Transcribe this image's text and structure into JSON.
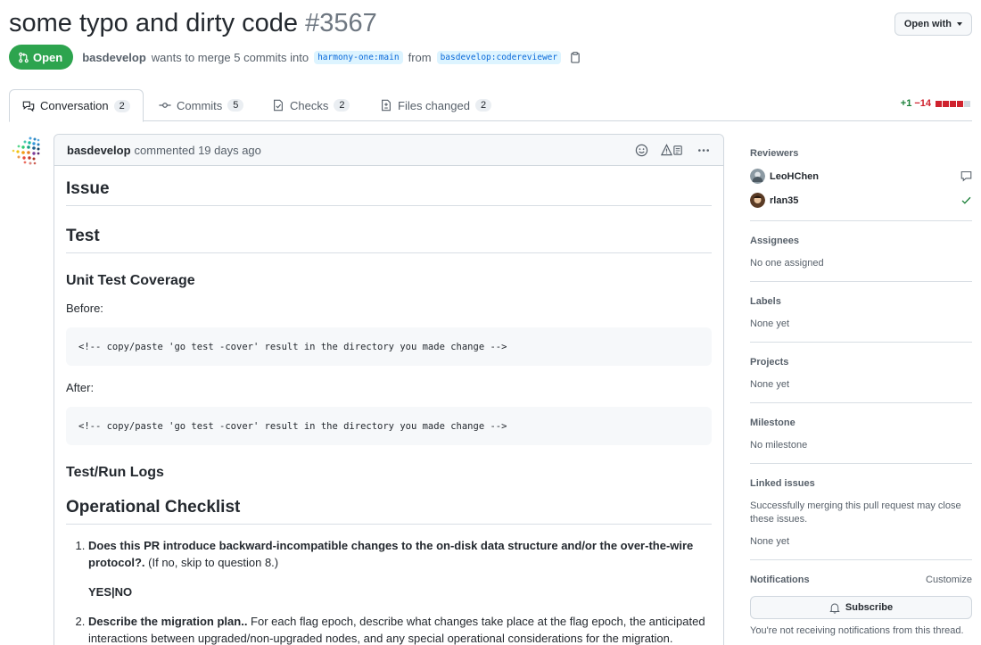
{
  "header": {
    "title": "some typo and dirty code",
    "number": "#3567",
    "open_with_label": "Open with"
  },
  "meta": {
    "state": "Open",
    "author": "basdevelop",
    "merge_text": "wants to merge 5 commits into",
    "base_branch": "harmony-one:main",
    "from_text": "from",
    "head_branch": "basdevelop:codereviewer"
  },
  "tabs": [
    {
      "label": "Conversation",
      "count": "2"
    },
    {
      "label": "Commits",
      "count": "5"
    },
    {
      "label": "Checks",
      "count": "2"
    },
    {
      "label": "Files changed",
      "count": "2"
    }
  ],
  "diffstat": {
    "additions": "+1",
    "deletions": "−14"
  },
  "comment": {
    "author": "basdevelop",
    "action": "commented 19 days ago",
    "h_issue": "Issue",
    "h_test": "Test",
    "h_coverage": "Unit Test Coverage",
    "before": "Before:",
    "code1": "<!-- copy/paste 'go test -cover' result in the directory you made change -->",
    "after": "After:",
    "code2": "<!-- copy/paste 'go test -cover' result in the directory you made change -->",
    "h_logs": "Test/Run Logs",
    "h_checklist": "Operational Checklist",
    "q1_bold": "Does this PR introduce backward-incompatible changes to the on-disk data structure and/or the over-the-wire protocol?.",
    "q1_rest": " (If no, skip to question 8.)",
    "q1_answer": "YES|NO",
    "q2_bold": "Describe the migration plan..",
    "q2_rest": " For each flag epoch, describe what changes take place at the flag epoch, the anticipated interactions between upgraded/non-upgraded nodes, and any special operational considerations for the migration."
  },
  "sidebar": {
    "reviewers_title": "Reviewers",
    "reviewers": [
      {
        "name": "LeoHChen"
      },
      {
        "name": "rlan35"
      }
    ],
    "assignees_title": "Assignees",
    "assignees_value": "No one assigned",
    "labels_title": "Labels",
    "labels_value": "None yet",
    "projects_title": "Projects",
    "projects_value": "None yet",
    "milestone_title": "Milestone",
    "milestone_value": "No milestone",
    "linked_title": "Linked issues",
    "linked_desc": "Successfully merging this pull request may close these issues.",
    "linked_value": "None yet",
    "notifications_title": "Notifications",
    "customize_label": "Customize",
    "subscribe_label": "Subscribe",
    "notice": "You're not receiving notifications from this thread."
  },
  "colors": {
    "open_green": "#2da44e",
    "link_blue": "#0969da",
    "add_green": "#1a7f37",
    "delete_red": "#cf222e"
  }
}
